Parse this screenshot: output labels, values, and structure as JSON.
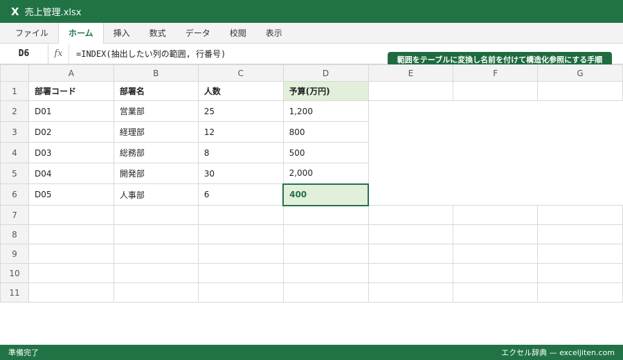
{
  "window": {
    "icon_letter": "X",
    "title": "売上管理.xlsx"
  },
  "ribbon": {
    "tabs": [
      "ファイル",
      "ホーム",
      "挿入",
      "数式",
      "データ",
      "校閲",
      "表示"
    ],
    "active_tab": "ホーム"
  },
  "formula_bar": {
    "name_box": "D6",
    "fx_label": "fx",
    "formula": "=INDEX(抽出したい列の範囲, 行番号)"
  },
  "callout": {
    "text": "範囲をテーブルに変換し名前を付けて構造化参照にする手順"
  },
  "sheet": {
    "columns": [
      "A",
      "B",
      "C",
      "D",
      "E",
      "F",
      "G"
    ],
    "rows": [
      "1",
      "2",
      "3",
      "4",
      "5",
      "6",
      "7",
      "8",
      "9",
      "10",
      "11"
    ],
    "table_header": [
      "部署コード",
      "部署名",
      "人数",
      "予算(万円)"
    ],
    "table_rows": [
      [
        "D01",
        "営業部",
        "25",
        "1,200"
      ],
      [
        "D02",
        "経理部",
        "12",
        "800"
      ],
      [
        "D03",
        "総務部",
        "8",
        "500"
      ],
      [
        "D04",
        "開発部",
        "30",
        "2,000"
      ],
      [
        "D05",
        "人事部",
        "6",
        "400"
      ]
    ],
    "selected_cell": "D6"
  },
  "status": {
    "left": "準備完了",
    "right": "エクセル辞典 — exceljiten.com"
  },
  "colors": {
    "accent": "#217346",
    "budget_fill": "#e2efda"
  }
}
